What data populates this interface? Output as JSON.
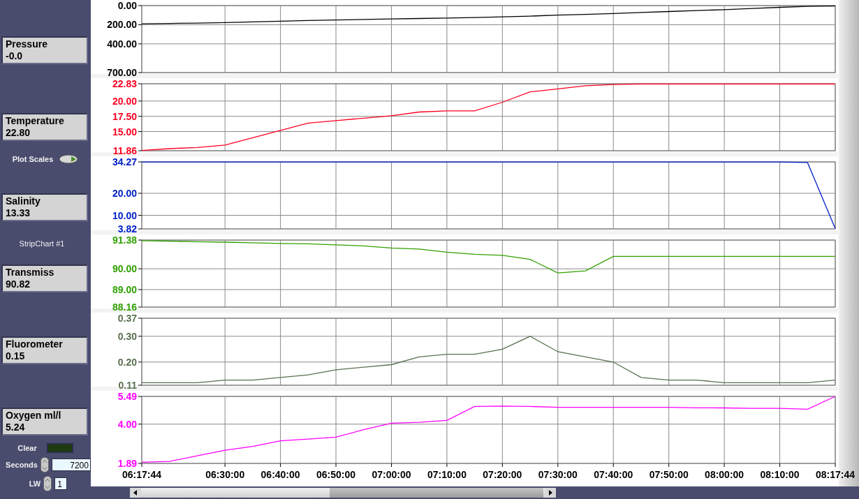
{
  "controls": [
    {
      "kind": "indicator",
      "label": "Pressure",
      "value": "-0.0"
    },
    {
      "kind": "indicator",
      "label": "Temperature",
      "value": "22.80"
    },
    {
      "kind": "toggle",
      "label": "Plot Scales"
    },
    {
      "kind": "indicator",
      "label": "Salinity",
      "value": "13.33"
    },
    {
      "kind": "caption",
      "label": "StripChart #1"
    },
    {
      "kind": "indicator",
      "label": "Transmiss",
      "value": "90.82"
    },
    {
      "kind": "indicator",
      "label": "Fluorometer",
      "value": "0.15"
    },
    {
      "kind": "indicator",
      "label": "Oxygen ml/l",
      "value": "5.24"
    },
    {
      "kind": "led_button",
      "label": "Clear",
      "on": false
    },
    {
      "kind": "numeric",
      "label": "Seconds",
      "value": "7200"
    },
    {
      "kind": "numeric",
      "label": "LW",
      "value": "1"
    }
  ],
  "plots": [
    {
      "chart_data": {
        "type": "line",
        "categories": [
          null,
          null,
          null,
          null,
          null,
          null,
          null,
          null,
          null,
          null,
          null,
          null,
          null,
          null,
          null,
          null,
          null,
          null,
          null,
          null,
          null,
          null,
          null,
          null,
          null,
          null
        ],
        "grid": true,
        "ylim": [
          700,
          0
        ],
        "yticks": [
          {
            "value": 0,
            "label": "0.00"
          },
          {
            "value": 200,
            "label": "200.00"
          },
          {
            "value": 400,
            "label": "400.00"
          },
          {
            "value": 700,
            "label": "700.00"
          }
        ],
        "series": [
          {
            "color": "#000000",
            "values": [
              190,
              187,
              183,
              178,
              170,
              163,
              155,
              150,
              145,
              140,
              135,
              130,
              125,
              118,
              110,
              100,
              92,
              83,
              72,
              62,
              52,
              42,
              30,
              18,
              8,
              5
            ]
          }
        ]
      }
    },
    {
      "chart_data": {
        "type": "line",
        "categories": [
          null,
          null,
          null,
          null,
          null,
          null,
          null,
          null,
          null,
          null,
          null,
          null,
          null,
          null,
          null,
          null,
          null,
          null,
          null,
          null,
          null,
          null,
          null,
          null,
          null,
          null
        ],
        "grid": true,
        "ylim": [
          11.86,
          22.83
        ],
        "yticks": [
          {
            "value": 11.86,
            "label": "11.86"
          },
          {
            "value": 15,
            "label": "15.00"
          },
          {
            "value": 17.5,
            "label": "17.50"
          },
          {
            "value": 20,
            "label": "20.00"
          },
          {
            "value": 22.83,
            "label": "22.83"
          }
        ],
        "series": [
          {
            "color": "#ff0020",
            "values": [
              11.9,
              12.2,
              12.4,
              12.8,
              14.0,
              15.2,
              16.4,
              16.8,
              17.2,
              17.6,
              18.2,
              18.4,
              18.4,
              19.8,
              21.5,
              22.0,
              22.5,
              22.7,
              22.8,
              22.8,
              22.8,
              22.8,
              22.8,
              22.8,
              22.8,
              22.8
            ]
          }
        ]
      }
    },
    {
      "chart_data": {
        "type": "line",
        "categories": [
          null,
          null,
          null,
          null,
          null,
          null,
          null,
          null,
          null,
          null,
          null,
          null,
          null,
          null,
          null,
          null,
          null,
          null,
          null,
          null,
          null,
          null,
          null,
          null,
          null,
          null
        ],
        "grid": true,
        "ylim": [
          3.82,
          34.27
        ],
        "yticks": [
          {
            "value": 3.82,
            "label": "3.82"
          },
          {
            "value": 10,
            "label": "10.00"
          },
          {
            "value": 20,
            "label": "20.00"
          },
          {
            "value": 34.27,
            "label": "34.27"
          }
        ],
        "series": [
          {
            "color": "#0020c8",
            "values": [
              34.2,
              34.2,
              34.2,
              34.2,
              34.2,
              34.2,
              34.2,
              34.2,
              34.2,
              34.2,
              34.2,
              34.2,
              34.2,
              34.2,
              34.2,
              34.2,
              34.2,
              34.2,
              34.2,
              34.2,
              34.2,
              34.2,
              34.2,
              34.2,
              34.0,
              4.0
            ]
          }
        ]
      }
    },
    {
      "chart_data": {
        "type": "line",
        "categories": [
          null,
          null,
          null,
          null,
          null,
          null,
          null,
          null,
          null,
          null,
          null,
          null,
          null,
          null,
          null,
          null,
          null,
          null,
          null,
          null,
          null,
          null,
          null,
          null,
          null,
          null
        ],
        "grid": true,
        "ylim": [
          88.16,
          91.38
        ],
        "yticks": [
          {
            "value": 88.16,
            "label": "88.16"
          },
          {
            "value": 89,
            "label": "89.00"
          },
          {
            "value": 90,
            "label": "90.00"
          },
          {
            "value": 91.38,
            "label": "91.38"
          }
        ],
        "series": [
          {
            "color": "#30a000",
            "values": [
              91.35,
              91.33,
              91.3,
              91.28,
              91.25,
              91.22,
              91.2,
              91.15,
              91.1,
              91.0,
              90.95,
              90.8,
              90.7,
              90.65,
              90.45,
              89.8,
              89.9,
              90.6,
              90.6,
              90.6,
              90.6,
              90.6,
              90.6,
              90.6,
              90.6,
              90.6
            ]
          }
        ]
      }
    },
    {
      "chart_data": {
        "type": "line",
        "categories": [
          null,
          null,
          null,
          null,
          null,
          null,
          null,
          null,
          null,
          null,
          null,
          null,
          null,
          null,
          null,
          null,
          null,
          null,
          null,
          null,
          null,
          null,
          null,
          null,
          null,
          null
        ],
        "grid": true,
        "ylim": [
          0.11,
          0.37
        ],
        "yticks": [
          {
            "value": 0.11,
            "label": "0.11"
          },
          {
            "value": 0.2,
            "label": "0.20"
          },
          {
            "value": 0.3,
            "label": "0.30"
          },
          {
            "value": 0.37,
            "label": "0.37"
          }
        ],
        "series": [
          {
            "color": "#5a7050",
            "values": [
              0.12,
              0.12,
              0.12,
              0.13,
              0.13,
              0.14,
              0.15,
              0.17,
              0.18,
              0.19,
              0.22,
              0.23,
              0.23,
              0.25,
              0.3,
              0.24,
              0.22,
              0.2,
              0.14,
              0.13,
              0.13,
              0.12,
              0.12,
              0.12,
              0.12,
              0.13
            ]
          }
        ]
      }
    },
    {
      "chart_data": {
        "type": "line",
        "categories": [
          "06:17:44",
          null,
          null,
          "06:30:00",
          null,
          "06:40:00",
          null,
          "06:50:00",
          null,
          "07:00:00",
          null,
          "07:10:00",
          null,
          "07:20:00",
          null,
          "07:30:00",
          null,
          "07:40:00",
          null,
          "07:50:00",
          null,
          "08:00:00",
          null,
          "08:10:00",
          null,
          "08:17:44"
        ],
        "grid": true,
        "ylim": [
          1.89,
          5.49
        ],
        "yticks": [
          {
            "value": 1.89,
            "label": "1.89"
          },
          {
            "value": 4,
            "label": "4.00"
          },
          {
            "value": 5.49,
            "label": "5.49"
          }
        ],
        "series": [
          {
            "color": "#ff00ff",
            "values": [
              1.95,
              2.0,
              2.3,
              2.6,
              2.8,
              3.1,
              3.2,
              3.3,
              3.7,
              4.05,
              4.1,
              4.2,
              4.95,
              4.97,
              4.95,
              4.9,
              4.9,
              4.9,
              4.9,
              4.9,
              4.88,
              4.87,
              4.85,
              4.85,
              4.8,
              5.49
            ]
          }
        ]
      }
    }
  ]
}
